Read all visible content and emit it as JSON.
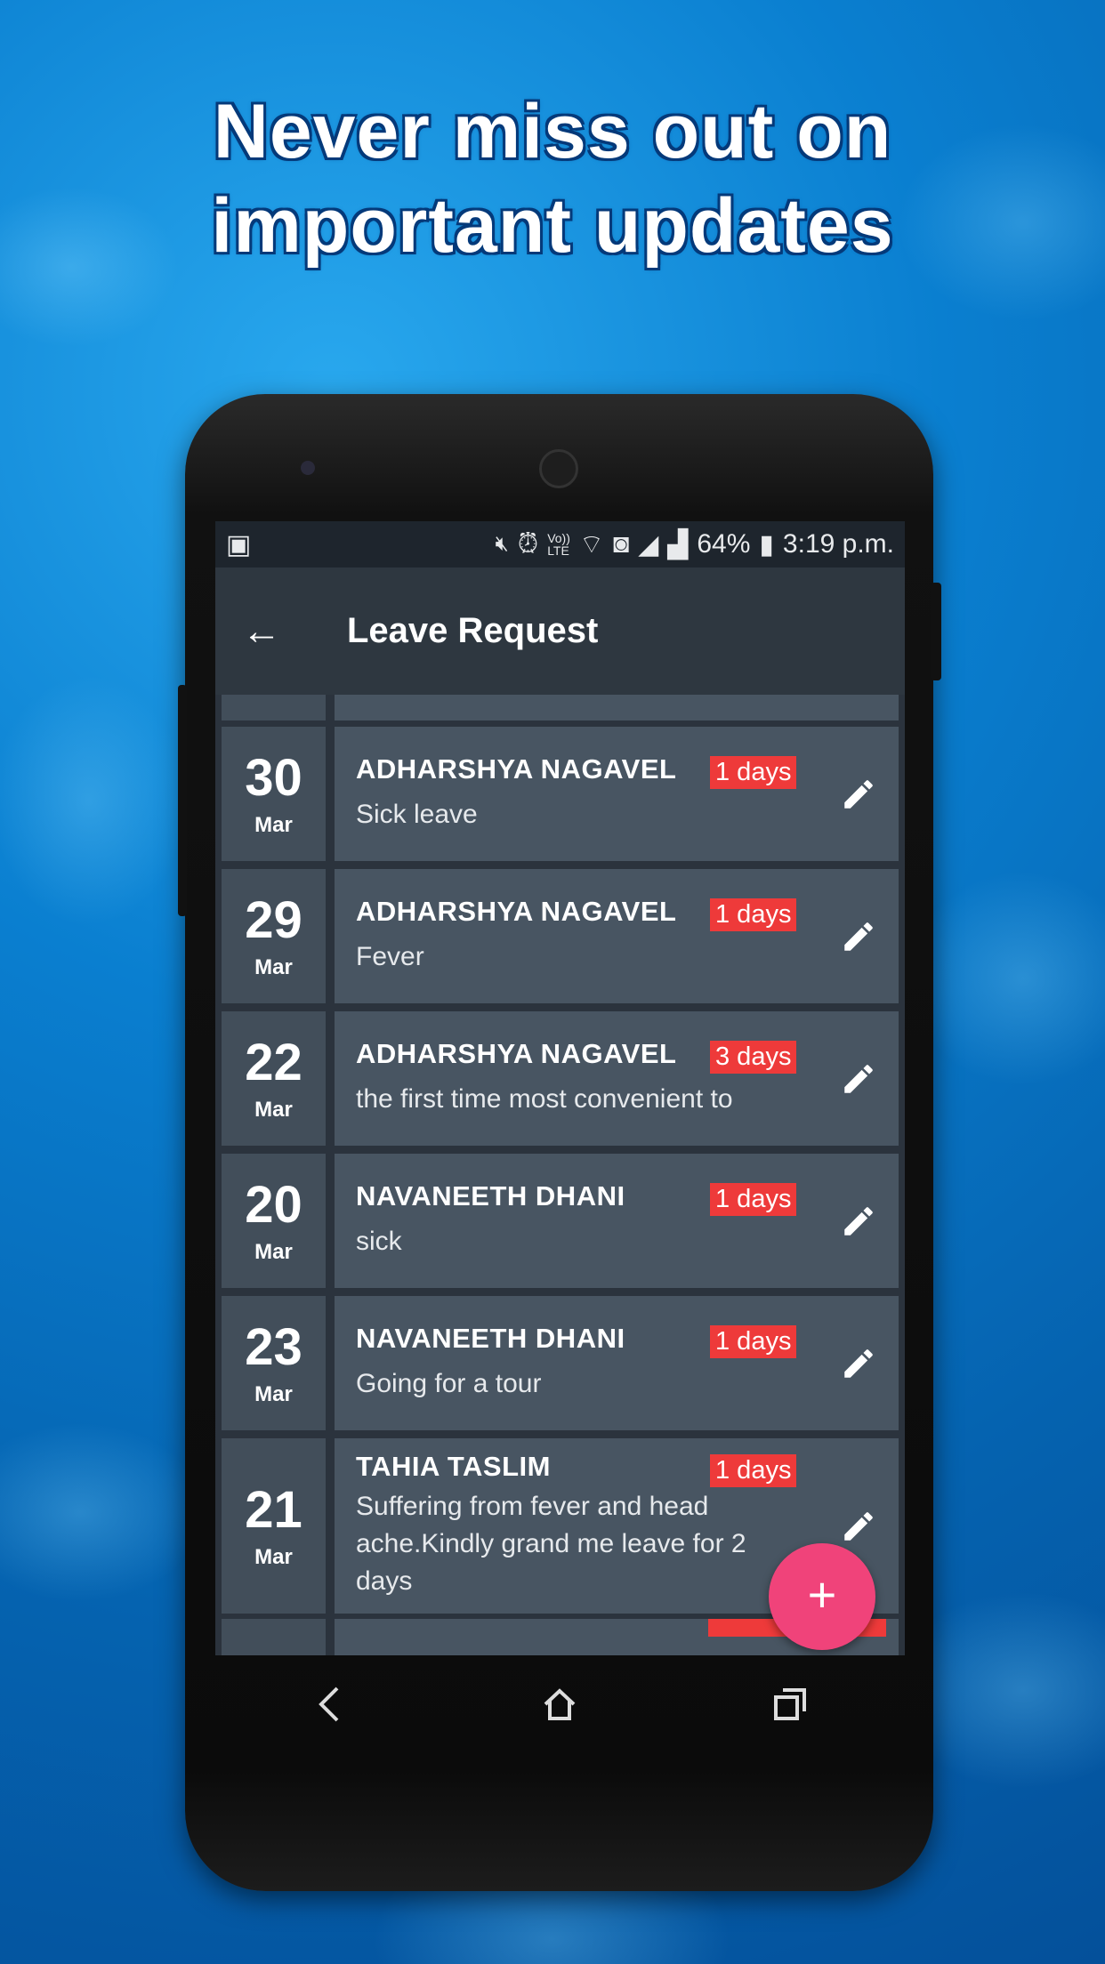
{
  "promo": {
    "headline_line1": "Never miss out on",
    "headline_line2": "important updates"
  },
  "status_bar": {
    "battery": "64%",
    "time": "3:19 p.m.",
    "icons": [
      "image-icon",
      "mute-icon",
      "alarm-icon",
      "volte-icon",
      "wifi-icon",
      "data-saver-icon",
      "signal-icon",
      "signal-icon",
      "battery-charging-icon"
    ]
  },
  "app_bar": {
    "title": "Leave Request",
    "back_icon": "arrow-left-icon"
  },
  "colors": {
    "badge": "#ee3a3a",
    "fab": "#f0437a",
    "card": "#485562",
    "date": "#424e5a"
  },
  "leave_requests": [
    {
      "day": "30",
      "month": "Mar",
      "name": "ADHARSHYA  NAGAVEL",
      "duration": "1 days",
      "reason": "Sick leave"
    },
    {
      "day": "29",
      "month": "Mar",
      "name": "ADHARSHYA  NAGAVEL",
      "duration": "1 days",
      "reason": "Fever"
    },
    {
      "day": "22",
      "month": "Mar",
      "name": "ADHARSHYA  NAGAVEL",
      "duration": "3 days",
      "reason": "the first time most convenient to"
    },
    {
      "day": "20",
      "month": "Mar",
      "name": "NAVANEETH DHANI",
      "duration": "1 days",
      "reason": "sick"
    },
    {
      "day": "23",
      "month": "Mar",
      "name": "NAVANEETH DHANI",
      "duration": "1 days",
      "reason": "Going for a tour"
    },
    {
      "day": "21",
      "month": "Mar",
      "name": "TAHIA TASLIM",
      "duration": "1 days",
      "reason": "Suffering from fever and head ache.Kindly grand me leave for 2 days"
    }
  ],
  "fab": {
    "label": "+"
  },
  "nav_bar": {
    "back": "back-icon",
    "home": "home-icon",
    "recents": "recents-icon"
  }
}
